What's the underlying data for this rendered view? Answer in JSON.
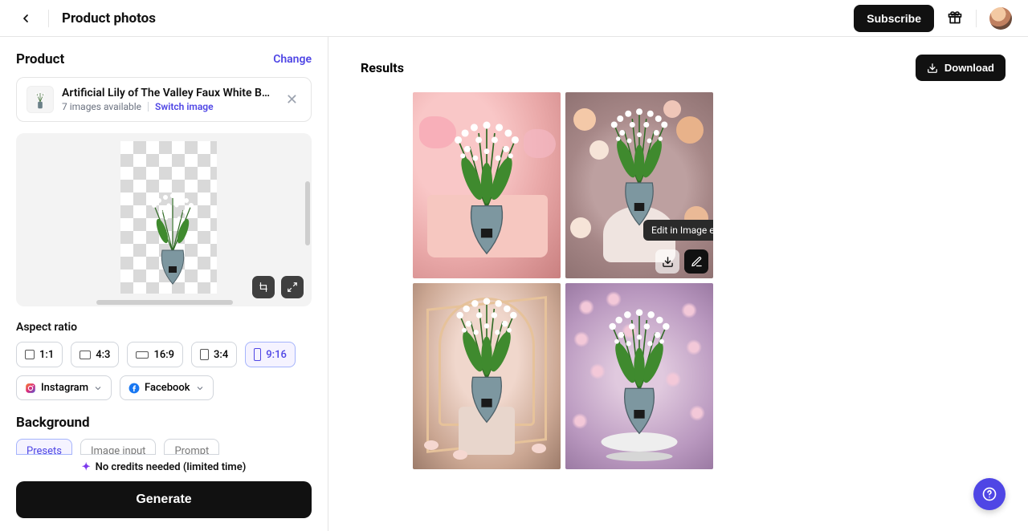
{
  "header": {
    "title": "Product photos",
    "subscribe": "Subscribe"
  },
  "left": {
    "product": {
      "section_label": "Product",
      "change": "Change",
      "title": "Artificial Lily of The Valley Faux White Bell Flow…",
      "images_available": "7 images available",
      "switch": "Switch image"
    },
    "aspect": {
      "label": "Aspect ratio",
      "opts": [
        "1:1",
        "4:3",
        "16:9",
        "3:4",
        "9:16"
      ]
    },
    "social": {
      "instagram": "Instagram",
      "facebook": "Facebook"
    },
    "background": {
      "label": "Background",
      "tabs": [
        "Presets",
        "Image input",
        "Prompt"
      ]
    },
    "credits": "No credits needed (limited time)",
    "generate": "Generate"
  },
  "right": {
    "title": "Results",
    "download": "Download",
    "tooltip": "Edit in Image editor"
  }
}
